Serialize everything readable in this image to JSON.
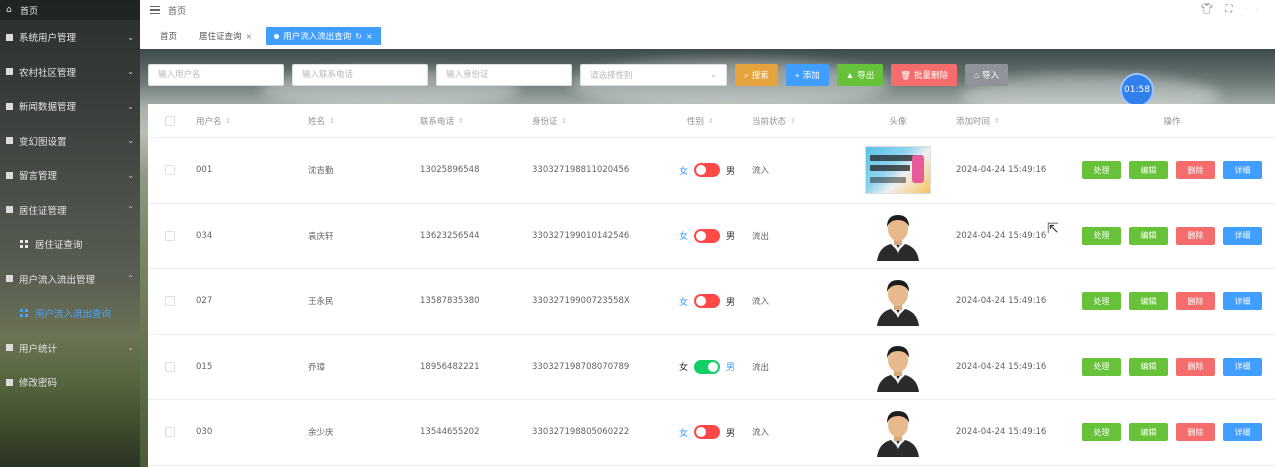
{
  "sidebar": {
    "home": "首页",
    "items": [
      {
        "label": "系统用户管理",
        "chevron": "⌄"
      },
      {
        "label": "农村社区管理",
        "chevron": "⌄"
      },
      {
        "label": "新闻数据管理",
        "chevron": "⌄"
      },
      {
        "label": "变幻图设置",
        "chevron": "⌄"
      },
      {
        "label": "留言管理",
        "chevron": "⌄"
      },
      {
        "label": "居住证管理",
        "chevron": "⌃"
      },
      {
        "label": "居住证查询",
        "sub": true
      },
      {
        "label": "用户流入流出管理",
        "chevron": "⌃"
      },
      {
        "label": "用户流入流出查询",
        "sub": true,
        "active": true
      },
      {
        "label": "用户统计",
        "chevron": "⌄"
      },
      {
        "label": "修改密码"
      }
    ]
  },
  "topbar": {
    "breadcrumb": "首页"
  },
  "tags": [
    {
      "label": "首页"
    },
    {
      "label": "居住证查询",
      "close": "×"
    },
    {
      "label": "用户流入流出查询",
      "refresh": "↻",
      "close": "×",
      "active": true
    }
  ],
  "search": {
    "username_placeholder": "输入用户名",
    "phone_placeholder": "输入联系电话",
    "idcard_placeholder": "输入身份证",
    "gender_placeholder": "请选择性别",
    "search_btn": "搜索",
    "add_btn": "添加",
    "export_btn": "导出",
    "batch_delete_btn": "批量删除",
    "import_btn": "导入"
  },
  "timer": "01:58",
  "table": {
    "headers": {
      "username": "用户名",
      "name": "姓名",
      "phone": "联系电话",
      "idcard": "身份证",
      "gender": "性别",
      "status": "当前状态",
      "avatar": "头像",
      "added": "添加时间",
      "ops": "操作"
    },
    "sort_icon": "⇕",
    "female": "女",
    "male": "男",
    "ops": {
      "handle": "处理",
      "edit": "编辑",
      "delete": "删除",
      "detail": "详细"
    },
    "rows": [
      {
        "username": "001",
        "name": "沈吉勤",
        "phone": "13025896548",
        "idcard": "330327198811020456",
        "gender": "female",
        "status": "流入",
        "added": "2024-04-24 15:49:16",
        "avatar": "image"
      },
      {
        "username": "034",
        "name": "袁庆轩",
        "phone": "13623256544",
        "idcard": "330327199010142546",
        "gender": "female",
        "status": "流出",
        "added": "2024-04-24 15:49:16",
        "avatar": "person"
      },
      {
        "username": "027",
        "name": "王永民",
        "phone": "13587835380",
        "idcard": "33032719900723558X",
        "gender": "female",
        "status": "流入",
        "added": "2024-04-24 15:49:16",
        "avatar": "person"
      },
      {
        "username": "015",
        "name": "乔璋",
        "phone": "18956482221",
        "idcard": "330327198708070789",
        "gender": "male",
        "status": "流出",
        "added": "2024-04-24 15:49:16",
        "avatar": "person"
      },
      {
        "username": "030",
        "name": "余少庆",
        "phone": "13544655202",
        "idcard": "330327198805060222",
        "gender": "female",
        "status": "流入",
        "added": "2024-04-24 15:49:16",
        "avatar": "person"
      }
    ]
  },
  "colors": {
    "primary": "#409eff",
    "success": "#67c23a",
    "danger": "#f56c6c",
    "warning": "#e6a23c",
    "switch_off": "#ff4949",
    "switch_on": "#13ce66"
  }
}
